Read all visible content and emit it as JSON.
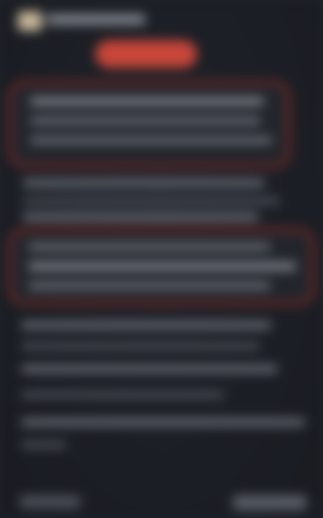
{
  "header": {
    "title": ""
  },
  "primary_button": {
    "label": ""
  },
  "sections": [
    {
      "lines": [
        "",
        "",
        ""
      ]
    },
    {
      "lines": [
        "",
        "",
        ""
      ]
    },
    {
      "lines": [
        "",
        "",
        ""
      ]
    },
    {
      "lines": [
        "",
        "",
        "",
        "",
        ""
      ]
    }
  ],
  "footer": {
    "left_label": "",
    "right_label": ""
  },
  "colors": {
    "background": "#1f2229",
    "accent": "#c8463a",
    "highlight_border": "#7a2a28"
  }
}
